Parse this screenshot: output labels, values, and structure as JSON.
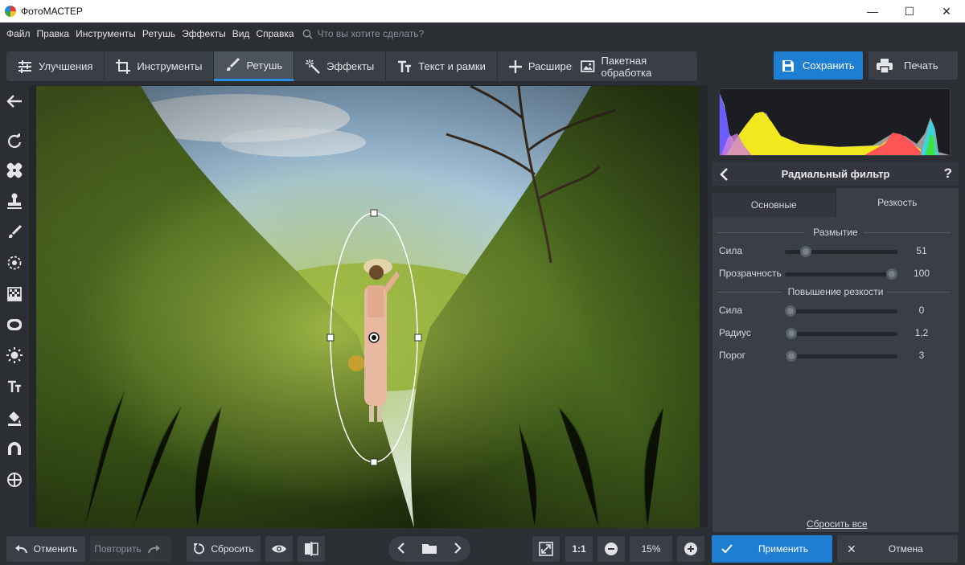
{
  "window": {
    "title": "ФотоМАСТЕР",
    "controls": [
      "—",
      "☐",
      "✕"
    ]
  },
  "menu": {
    "items": [
      "Файл",
      "Правка",
      "Инструменты",
      "Ретушь",
      "Эффекты",
      "Вид",
      "Справка"
    ],
    "search_placeholder": "Что вы хотите сделать?"
  },
  "tabs": [
    {
      "label": "Улучшения",
      "icon": "sliders-icon"
    },
    {
      "label": "Инструменты",
      "icon": "crop-icon"
    },
    {
      "label": "Ретушь",
      "icon": "brush-icon",
      "active": true
    },
    {
      "label": "Эффекты",
      "icon": "magic-wand-icon"
    },
    {
      "label": "Текст и рамки",
      "icon": "text-icon"
    },
    {
      "label": "Расширения",
      "icon": "plus-icon"
    }
  ],
  "toolbar": {
    "batch_label": "Пакетная обработка",
    "save_label": "Сохранить",
    "print_label": "Печать"
  },
  "tools": [
    "back-arrow-icon",
    "rotate-icon",
    "bandage-icon",
    "stamp-icon",
    "brush-icon",
    "target-icon",
    "gradient-icon",
    "radial-filter-icon",
    "sun-icon",
    "text-icon",
    "bucket-icon",
    "magnet-icon",
    "crosshair-icon"
  ],
  "panel": {
    "title": "Радиальный фильтр",
    "help": "?",
    "tab_basic": "Основные",
    "tab_sharpness": "Резкость",
    "blur_section": "Размытие",
    "sharpen_section": "Повышение резкости",
    "sliders": {
      "blur_strength": {
        "label": "Сила",
        "value": "51",
        "fraction": 0.15
      },
      "blur_opacity": {
        "label": "Прозрачность",
        "value": "100",
        "fraction": 1.0
      },
      "sharp_strength": {
        "label": "Сила",
        "value": "0",
        "fraction": 0.0
      },
      "sharp_radius": {
        "label": "Радиус",
        "value": "1,2",
        "fraction": 0.01
      },
      "sharp_threshold": {
        "label": "Порог",
        "value": "3",
        "fraction": 0.01
      }
    },
    "reset_all": "Сбросить все"
  },
  "bottom": {
    "undo_label": "Отменить",
    "redo_label": "Повторить",
    "reset_label": "Сбросить",
    "one_to_one": "1:1",
    "zoom": "15%",
    "apply_label": "Применить",
    "cancel_label": "Отмена"
  },
  "colors": {
    "accent": "#1e7fd2",
    "panel_bg": "#3a3e45",
    "app_bg": "#2b2e33"
  }
}
